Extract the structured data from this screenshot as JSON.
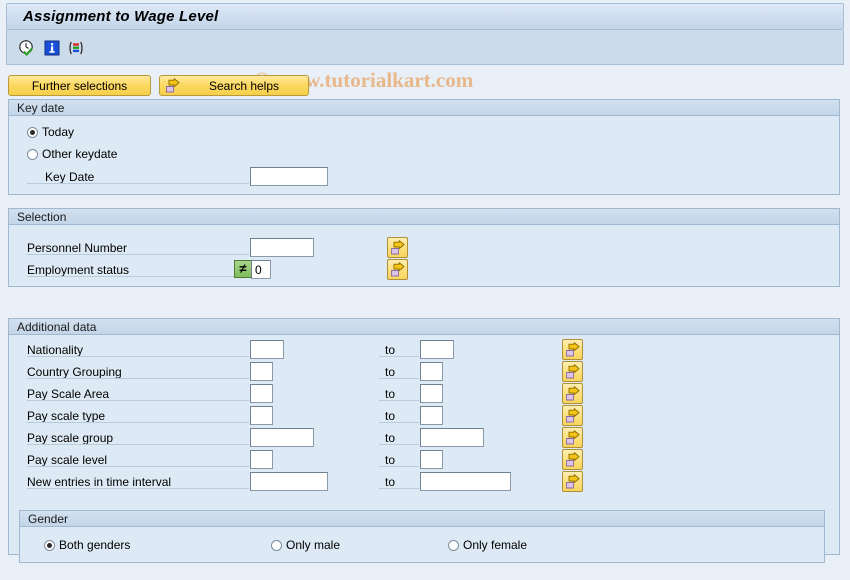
{
  "window": {
    "title": "Assignment to Wage Level"
  },
  "watermark": {
    "text": "© www.tutorialkart.com",
    "color": "#e8b78a"
  },
  "toolbar": {
    "icons": [
      {
        "name": "execute-clock-icon",
        "title": "Execute"
      },
      {
        "name": "info-icon",
        "title": "Information"
      },
      {
        "name": "variant-icon",
        "title": "Get Variant"
      }
    ]
  },
  "buttons": {
    "further_selections": "Further selections",
    "search_helps": "Search helps"
  },
  "key_date": {
    "group_title": "Key date",
    "options": [
      {
        "label": "Today",
        "selected": true
      },
      {
        "label": "Other keydate",
        "selected": false
      }
    ],
    "key_date_label": "Key Date",
    "key_date_value": ""
  },
  "selection": {
    "group_title": "Selection",
    "rows": [
      {
        "label": "Personnel Number",
        "value": "",
        "operator": "",
        "has_operator": false
      },
      {
        "label": "Employment status",
        "value": "0",
        "operator": "≠",
        "has_operator": true
      }
    ]
  },
  "additional_data": {
    "group_title": "Additional data",
    "to_label": "to",
    "rows": [
      {
        "label": "Nationality",
        "from": "",
        "to": ""
      },
      {
        "label": "Country Grouping",
        "from": "",
        "to": ""
      },
      {
        "label": "Pay Scale Area",
        "from": "",
        "to": ""
      },
      {
        "label": "Pay scale type",
        "from": "",
        "to": ""
      },
      {
        "label": "Pay scale group",
        "from": "",
        "to": ""
      },
      {
        "label": "Pay scale level",
        "from": "",
        "to": ""
      },
      {
        "label": "New entries in time interval",
        "from": "",
        "to": ""
      }
    ]
  },
  "gender": {
    "group_title": "Gender",
    "options": [
      {
        "label": "Both genders",
        "selected": true
      },
      {
        "label": "Only male",
        "selected": false
      },
      {
        "label": "Only female",
        "selected": false
      }
    ]
  },
  "colors": {
    "background": "#e9eff7",
    "panel": "#dde9f4",
    "titlebar": "#cfdef0",
    "button_yellow": "#fcd963",
    "operator_green": "#7fbd5c"
  }
}
